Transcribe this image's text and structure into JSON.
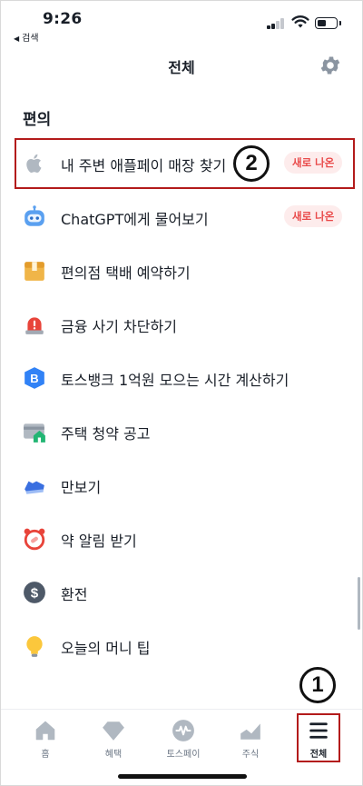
{
  "status_bar": {
    "time": "9:26",
    "back_label": "검색",
    "back_arrow": "◀"
  },
  "header": {
    "title": "전체",
    "settings_icon": "gear-icon"
  },
  "section": {
    "title": "편의",
    "items": [
      {
        "label": "내 주변 애플페이 매장 찾기",
        "icon": "apple-icon",
        "badge": "새로 나온"
      },
      {
        "label": "ChatGPT에게 물어보기",
        "icon": "robot-icon",
        "badge": "새로 나온"
      },
      {
        "label": "편의점 택배 예약하기",
        "icon": "package-icon"
      },
      {
        "label": "금융 사기 차단하기",
        "icon": "siren-icon"
      },
      {
        "label": "토스뱅크 1억원 모으는 시간 계산하기",
        "icon": "bank-b-icon"
      },
      {
        "label": "주택 청약 공고",
        "icon": "house-card-icon"
      },
      {
        "label": "만보기",
        "icon": "sneaker-icon"
      },
      {
        "label": "약 알림 받기",
        "icon": "alarm-clock-icon"
      },
      {
        "label": "환전",
        "icon": "dollar-icon"
      },
      {
        "label": "오늘의 머니 팁",
        "icon": "lightbulb-icon"
      }
    ]
  },
  "annotations": {
    "step1": "1",
    "step2": "2"
  },
  "tabbar": {
    "tabs": [
      {
        "label": "홈",
        "icon": "home-icon"
      },
      {
        "label": "혜택",
        "icon": "gem-icon"
      },
      {
        "label": "토스페이",
        "icon": "toss-pay-icon"
      },
      {
        "label": "주식",
        "icon": "stock-chart-icon"
      },
      {
        "label": "전체",
        "icon": "menu-icon",
        "active": true
      }
    ]
  },
  "colors": {
    "accent_red": "#b31b1b",
    "badge_bg": "#fdecec",
    "badge_text": "#e94a4a",
    "text": "#191f28",
    "muted": "#6b7684"
  }
}
